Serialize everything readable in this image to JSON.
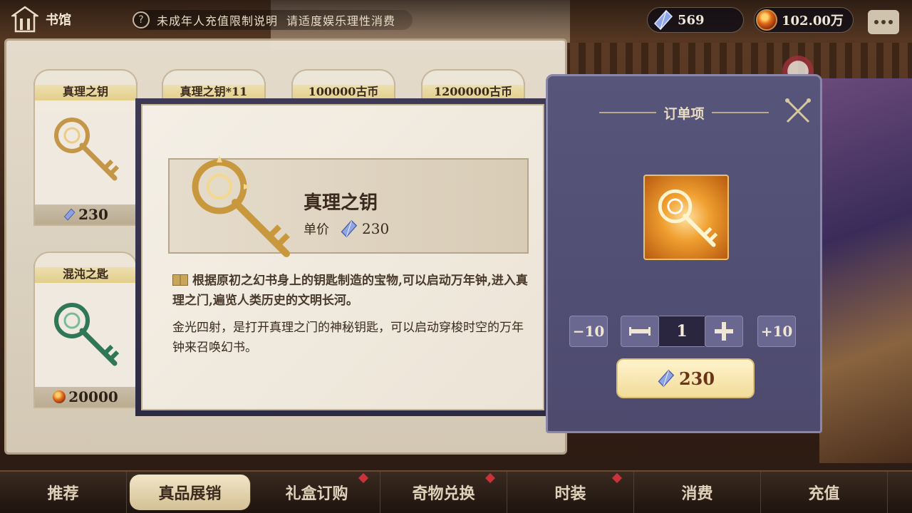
{
  "topbar": {
    "title": "书馆",
    "notice_left": "未成年人充值限制说明",
    "notice_right": "请适度娱乐理性消费",
    "crystal_amount": "569",
    "coin_amount": "102.00万"
  },
  "shop": {
    "cards": [
      {
        "name": "真理之钥",
        "price": "230",
        "currency": "crystal-icon"
      },
      {
        "name": "混沌之匙",
        "price": "20000",
        "currency": "coin-icon"
      },
      {
        "name": "真理之钥*11"
      },
      {
        "name": "100000古币"
      },
      {
        "name": "1200000古币"
      }
    ]
  },
  "detail": {
    "name": "真理之钥",
    "unit_label": "单价",
    "unit_price": "230",
    "description_1": "根据原初之幻书身上的钥匙制造的宝物,可以启动万年钟,进入真理之门,遍览人类历史的文明长河。",
    "description_2": "金光四射，是打开真理之门的神秘钥匙，可以启动穿梭时空的万年钟来召唤幻书。"
  },
  "order": {
    "title": "订单项",
    "minus10": "−10",
    "plus10": "+10",
    "quantity": "1",
    "total": "230"
  },
  "nav": {
    "items": [
      {
        "label": "推荐"
      },
      {
        "label": "真品展销"
      },
      {
        "label": "礼盒订购"
      },
      {
        "label": "奇物兑换"
      },
      {
        "label": "时装"
      },
      {
        "label": "消费"
      },
      {
        "label": "充值"
      }
    ],
    "active_index": 1
  },
  "colors": {
    "order_panel": "#57557a",
    "accent_gold": "#f1dc9a",
    "nav_badge": "#c8323a"
  }
}
